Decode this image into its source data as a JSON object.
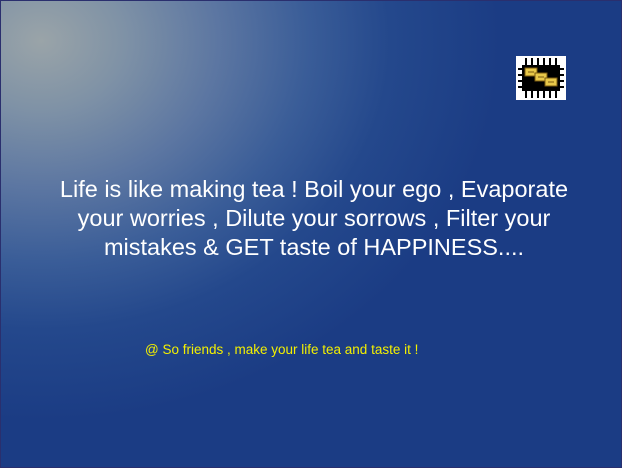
{
  "slide": {
    "logo_icon": "chip-logo-icon",
    "quote_lines": [
      "Life is like making tea ! Boil your ego , Evaporate",
      "your worries , Dilute your sorrows , Filter your",
      "mistakes & GET taste of HAPPINESS...."
    ],
    "caption": "@ So friends , make your life tea and taste it !"
  },
  "colors": {
    "background_dark": "#1b3c84",
    "background_light": "#9aa4a8",
    "quote_text": "#ffffff",
    "caption_text": "#f4f000"
  }
}
